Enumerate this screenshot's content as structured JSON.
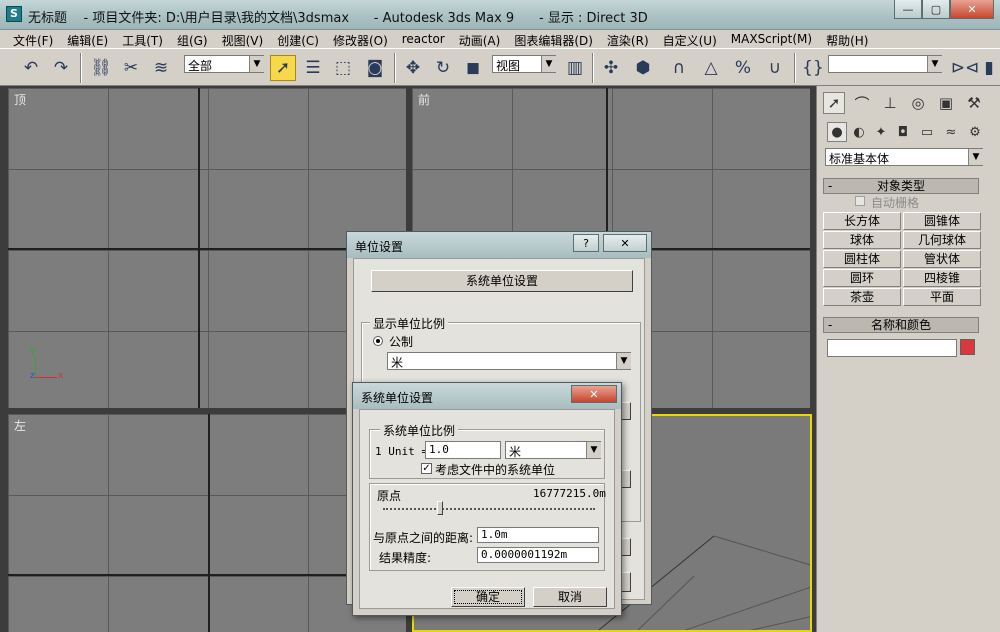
{
  "window": {
    "title": "无标题    - 项目文件夹: D:\\用户目录\\我的文档\\3dsmax      - Autodesk 3ds Max 9      - 显示 : Direct 3D",
    "minimize": "—",
    "maximize": "▢",
    "close": "✕"
  },
  "menu": [
    "文件(F)",
    "编辑(E)",
    "工具(T)",
    "组(G)",
    "视图(V)",
    "创建(C)",
    "修改器(O)",
    "reactor",
    "动画(A)",
    "图表编辑器(D)",
    "渲染(R)",
    "自定义(U)",
    "MAXScript(M)",
    "帮助(H)"
  ],
  "toolbar": {
    "selection_filter": "全部",
    "ref_coord": "视图",
    "named_selection": "",
    "dropdown_arrow": "▼"
  },
  "viewports": {
    "top": "顶",
    "front": "前",
    "left": "左",
    "axis_x": "x",
    "axis_y": "y",
    "axis_z": "z"
  },
  "command_panel": {
    "category_dropdown": "标准基本体",
    "object_type": {
      "header": "对象类型",
      "autogrid": "自动栅格",
      "buttons": [
        "长方体",
        "圆锥体",
        "球体",
        "几何球体",
        "圆柱体",
        "管状体",
        "圆环",
        "四棱锥",
        "茶壶",
        "平面"
      ]
    },
    "name_color": {
      "header": "名称和颜色",
      "name_value": "",
      "swatch_color": "#d9393c"
    },
    "minus": "-"
  },
  "units_dialog": {
    "title": "单位设置",
    "help": "?",
    "close": "✕",
    "system_button": "系统单位设置",
    "display_group": "显示单位比例",
    "metric_label": "公制",
    "metric_value": "米"
  },
  "system_dialog": {
    "title": "系统单位设置",
    "close": "✕",
    "scale_group": "系统单位比例",
    "unit_prefix": "1 Unit =",
    "unit_value": "1.0",
    "unit_type": "米",
    "respect_label": "考虑文件中的系统单位",
    "origin_label": "原点",
    "origin_value": "16777215.0m",
    "distance_label": "与原点之间的距离:",
    "distance_value": "1.0m",
    "precision_label": "结果精度:",
    "precision_value": "0.0000001192m",
    "ok": "确定",
    "cancel": "取消",
    "slider_position": 0.27
  },
  "colors": {
    "active_tool": "#f7d84a",
    "viewport_bg": "#7d7d7d",
    "active_viewport_border": "#e8d800"
  }
}
